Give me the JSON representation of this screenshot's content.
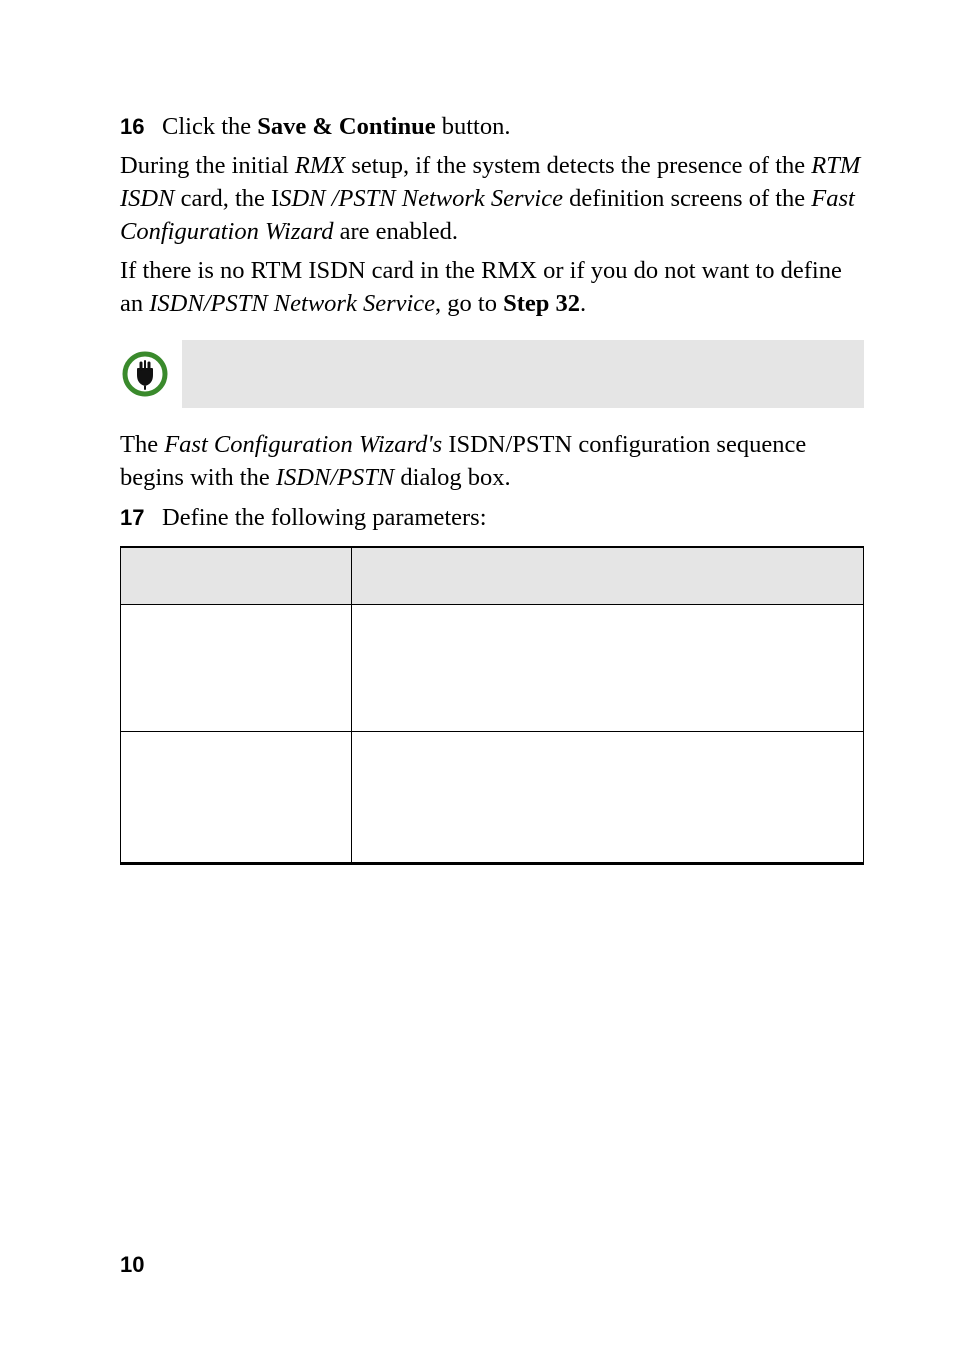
{
  "step16": {
    "num": "16",
    "prefix": "Click the ",
    "bold": "Save & Continue",
    "suffix": " button."
  },
  "para1": {
    "t0": "During the initial ",
    "i1": "RMX",
    "t1": " setup, if the system detects the presence of the ",
    "i2": "RTM ISDN",
    "t2": " card, the I",
    "i3": "SDN /PSTN Network Service",
    "t3": " definition screens of the ",
    "i4": "Fast Configuration Wizard",
    "t4": " are enabled."
  },
  "para2": {
    "t0": "If there is no RTM ISDN card in the RMX or if you do not want to define an ",
    "i1": "ISDN/PSTN Network Service",
    "t1": ", go to ",
    "b1": "Step 32",
    "t2": "."
  },
  "para3": {
    "t0": "The ",
    "i1": "Fast Configuration Wizard's",
    "t1": " ISDN/PSTN configuration sequence begins with the ",
    "i2": "ISDN/PSTN",
    "t2": " dialog box."
  },
  "step17": {
    "num": "17",
    "text": "Define the following parameters:"
  },
  "icons": {
    "plug": "plug-icon"
  },
  "footer": {
    "page_number": "10"
  }
}
